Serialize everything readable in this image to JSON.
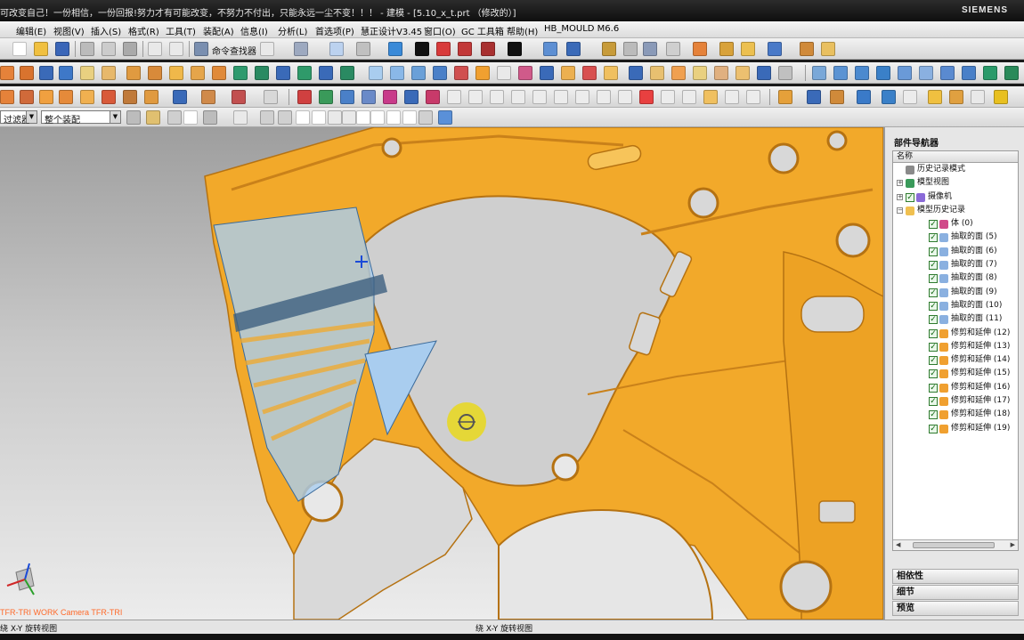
{
  "window": {
    "title": "可改变自己！一份相信，一份回报!努力才有可能改变，不努力不付出，只能永远一尘不变！！！ - 建模 - [5.10_x_t.prt （修改的）]",
    "brand": "SIEMENS"
  },
  "menu": [
    "编辑(E)",
    "视图(V)",
    "插入(S)",
    "格式(R)",
    "工具(T)",
    "装配(A)",
    "信息(I)",
    "分析(L)",
    "首选项(P)",
    "慧正设计V3.45",
    "窗口(O)",
    "GC 工具箱",
    "帮助(H)",
    "HB_MOULD M6.6"
  ],
  "toolbar": {
    "command_finder_label": "命令查找器"
  },
  "selection_bar": {
    "filter_value": "过滤器",
    "scope_value": "整个装配"
  },
  "viewport": {
    "view_label": "TFR-TRI WORK Camera TFR-TRI",
    "colors": {
      "part": "#f2a92a",
      "part_dark": "#c9811a",
      "highlight": "#a9cdef",
      "rotate_marker": "#e9d81c"
    }
  },
  "navigator": {
    "title": "部件导航器",
    "column_header": "名称",
    "items": [
      {
        "label": "历史记录模式",
        "level": 0,
        "icon": "clock-icon",
        "expander": "",
        "checked": false
      },
      {
        "label": "模型视图",
        "level": 0,
        "icon": "model-views-icon",
        "expander": "+",
        "checked": false
      },
      {
        "label": "摄像机",
        "level": 0,
        "icon": "camera-icon",
        "expander": "+",
        "checked": true
      },
      {
        "label": "模型历史记录",
        "level": 0,
        "icon": "folder-icon",
        "expander": "-",
        "checked": false
      },
      {
        "label": "体 (0)",
        "level": 1,
        "icon": "body-icon",
        "expander": "",
        "checked": true
      },
      {
        "label": "抽取的面 (5)",
        "level": 1,
        "icon": "extract-face-icon",
        "expander": "",
        "checked": true
      },
      {
        "label": "抽取的面 (6)",
        "level": 1,
        "icon": "extract-face-icon",
        "expander": "",
        "checked": true
      },
      {
        "label": "抽取的面 (7)",
        "level": 1,
        "icon": "extract-face-icon",
        "expander": "",
        "checked": true
      },
      {
        "label": "抽取的面 (8)",
        "level": 1,
        "icon": "extract-face-icon",
        "expander": "",
        "checked": true
      },
      {
        "label": "抽取的面 (9)",
        "level": 1,
        "icon": "extract-face-icon",
        "expander": "",
        "checked": true
      },
      {
        "label": "抽取的面 (10)",
        "level": 1,
        "icon": "extract-face-icon",
        "expander": "",
        "checked": true
      },
      {
        "label": "抽取的面 (11)",
        "level": 1,
        "icon": "extract-face-icon",
        "expander": "",
        "checked": true
      },
      {
        "label": "修剪和延伸 (12)",
        "level": 1,
        "icon": "trim-extend-icon",
        "expander": "",
        "checked": true
      },
      {
        "label": "修剪和延伸 (13)",
        "level": 1,
        "icon": "trim-extend-icon",
        "expander": "",
        "checked": true
      },
      {
        "label": "修剪和延伸 (14)",
        "level": 1,
        "icon": "trim-extend-icon",
        "expander": "",
        "checked": true
      },
      {
        "label": "修剪和延伸 (15)",
        "level": 1,
        "icon": "trim-extend-icon",
        "expander": "",
        "checked": true
      },
      {
        "label": "修剪和延伸 (16)",
        "level": 1,
        "icon": "trim-extend-icon",
        "expander": "",
        "checked": true
      },
      {
        "label": "修剪和延伸 (17)",
        "level": 1,
        "icon": "trim-extend-icon",
        "expander": "",
        "checked": true
      },
      {
        "label": "修剪和延伸 (18)",
        "level": 1,
        "icon": "trim-extend-icon",
        "expander": "",
        "checked": true
      },
      {
        "label": "修剪和延伸 (19)",
        "level": 1,
        "icon": "trim-extend-icon",
        "expander": "",
        "checked": true
      }
    ],
    "panels": [
      "相依性",
      "细节",
      "预览"
    ]
  },
  "status": {
    "left": "绕 X-Y 旋转视图",
    "center": "绕 X-Y 旋转视图"
  }
}
